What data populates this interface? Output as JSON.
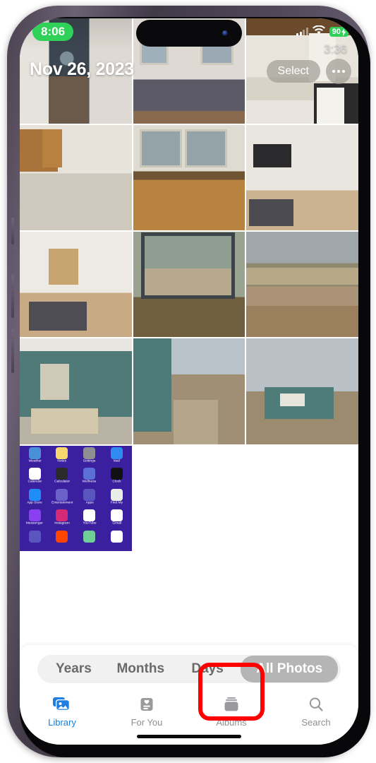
{
  "device": {
    "name": "iphone-14-pro",
    "frame_color": "#55495e"
  },
  "status_bar": {
    "recording_time": "8:06",
    "screen_time": "3:36",
    "battery_level": "90",
    "battery_charging": true,
    "cellular_icon": "cellular-signal-icon",
    "wifi_icon": "wifi-icon",
    "battery_icon": "battery-icon"
  },
  "header": {
    "date": "Nov 26, 2023",
    "select_label": "Select",
    "more_icon": "ellipsis-icon"
  },
  "photo_grid": {
    "rows": [
      [
        {
          "name": "hallway-doorway-photo",
          "art": "p-hall"
        },
        {
          "name": "bedroom-photo",
          "art": "p-bed"
        },
        {
          "name": "kitchen-stove-photo",
          "art": "p-kitchA"
        }
      ],
      [
        {
          "name": "kitchen-cabinets-photo",
          "art": "p-kitchB"
        },
        {
          "name": "kitchen-sink-window-photo",
          "art": "p-sink"
        },
        {
          "name": "living-room-tv-photo",
          "art": "p-living"
        }
      ],
      [
        {
          "name": "living-room-open-plan-photo",
          "art": "p-lr2"
        },
        {
          "name": "bay-window-backyard-photo",
          "art": "p-window"
        },
        {
          "name": "backyard-fence-photo",
          "art": "p-yard"
        }
      ],
      [
        {
          "name": "front-porch-photo",
          "art": "p-porch"
        },
        {
          "name": "side-walkway-photo",
          "art": "p-side"
        },
        {
          "name": "house-exterior-photo",
          "art": "p-house"
        }
      ]
    ],
    "last_row": {
      "name": "home-screen-screenshot",
      "art": "p-homescreen"
    }
  },
  "home_screen_thumbnail": {
    "apps": [
      {
        "label": "Weather",
        "color": "#4a90d9"
      },
      {
        "label": "Notes",
        "color": "#f5d76e"
      },
      {
        "label": "Settings",
        "color": "#8e8e93"
      },
      {
        "label": "Mail",
        "color": "#2f8bf0"
      },
      {
        "label": "Calendar",
        "color": "#ffffff"
      },
      {
        "label": "Calculator",
        "color": "#2b2b2b"
      },
      {
        "label": "Wellness",
        "color": "#5b6fd6"
      },
      {
        "label": "Clock",
        "color": "#111111"
      },
      {
        "label": "App Store",
        "color": "#1f8df5"
      },
      {
        "label": "Entertainment",
        "color": "#6a62c8"
      },
      {
        "label": "Apps",
        "color": "#5a56c0"
      },
      {
        "label": "Find My",
        "color": "#e9ede8"
      },
      {
        "label": "Messenger",
        "color": "#8a3ff0"
      },
      {
        "label": "Instagram",
        "color": "#d62976"
      },
      {
        "label": "YouTube",
        "color": "#ffffff"
      },
      {
        "label": "Gmail",
        "color": "#ffffff"
      },
      {
        "label": "",
        "color": "#5a56c0"
      },
      {
        "label": "",
        "color": "#ff4500"
      },
      {
        "label": "",
        "color": "#6fcf97"
      },
      {
        "label": "",
        "color": "#ffffff"
      }
    ]
  },
  "segmented_control": {
    "items": [
      {
        "label": "Years",
        "selected": false
      },
      {
        "label": "Months",
        "selected": false
      },
      {
        "label": "Days",
        "selected": false
      },
      {
        "label": "All Photos",
        "selected": true
      }
    ],
    "selected_bg": "#b5b5b5",
    "track_bg": "#f1f1f1"
  },
  "tab_bar": {
    "items": [
      {
        "label": "Library",
        "icon": "photo-stack-icon",
        "active": true
      },
      {
        "label": "For You",
        "icon": "for-you-card-icon",
        "active": false
      },
      {
        "label": "Albums",
        "icon": "albums-stack-icon",
        "active": false,
        "highlighted": true
      },
      {
        "label": "Search",
        "icon": "magnifier-icon",
        "active": false
      }
    ],
    "active_color": "#1280e4",
    "inactive_color": "#8e8e93"
  },
  "annotation": {
    "shape": "rounded-rectangle",
    "color": "#ff0000",
    "target": "Albums"
  }
}
